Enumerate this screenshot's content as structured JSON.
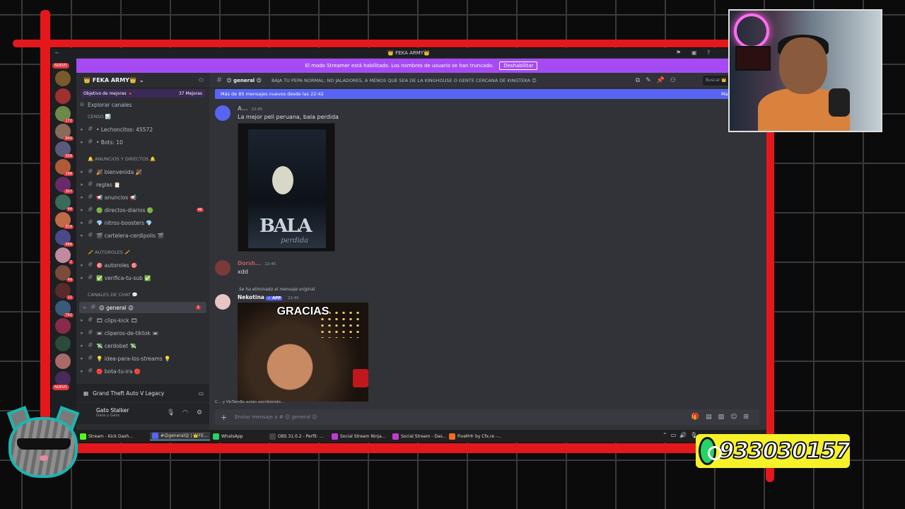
{
  "titlebar": {
    "title": "👑 FEKA ARMY👑"
  },
  "streamer_bar": {
    "message": "El modo Streamer está habilitado. Los nombres de usuario se han truncado.",
    "button": "Deshabilitar"
  },
  "servers": {
    "nuevo_top": "NUEVO",
    "nuevo_bottom": "NUEVO",
    "counts": [
      "172",
      "640",
      "508",
      "198",
      "307",
      "44",
      "819",
      "488",
      "1",
      "49",
      "11",
      "742"
    ]
  },
  "sidebar": {
    "server_name": "👑 FEKA ARMY👑",
    "boost_goal": "Objetivo de mejoras 🔺",
    "boost_count": "37 Mejoras",
    "explore": "Explorar canales",
    "items": [
      {
        "type": "cat",
        "label": "CENSO 📊"
      },
      {
        "type": "ch",
        "label": "• Lechoncitos: 45572"
      },
      {
        "type": "ch",
        "label": "• Bots: 10"
      },
      {
        "type": "cat",
        "label": "🔔 ANUNCIOS Y DIRECTOS 🔔"
      },
      {
        "type": "ch",
        "label": "🎉 bienvenida 🎉"
      },
      {
        "type": "ch",
        "label": "reglas 📋"
      },
      {
        "type": "ch",
        "label": "📢 anuncios 📢"
      },
      {
        "type": "ch",
        "label": "🟢 directos-diarios 🟢",
        "badge": "46"
      },
      {
        "type": "ch",
        "label": "💎 nitros-boosters 💎"
      },
      {
        "type": "ch",
        "label": "🎬 cartelera-cerdipolis 🎬"
      },
      {
        "type": "cat",
        "label": "🥕 AUTOROLES 🥕"
      },
      {
        "type": "ch",
        "label": "🎯 autoroles 🎯"
      },
      {
        "type": "ch",
        "label": "✅ verifica-tu-sub ✅"
      },
      {
        "type": "cat",
        "label": "CANALES DE CHAT 💬"
      },
      {
        "type": "ch",
        "label": "😉 general 😉",
        "badge": "1",
        "active": true
      },
      {
        "type": "ch",
        "label": "🎞 clips-kick 🎞"
      },
      {
        "type": "ch",
        "label": "📼 cliperos-de-tiktok 📼"
      },
      {
        "type": "ch",
        "label": "💸 cerdobet 💸"
      },
      {
        "type": "ch",
        "label": "💡 idea-para-los-streams 💡"
      },
      {
        "type": "ch",
        "label": "🔴 bota-tu-ira 🔴"
      }
    ],
    "voice_activity": "Grand Theft Auto V Legacy",
    "user_name": "Gato Stalker",
    "user_status": "Gata y Gato"
  },
  "channel": {
    "name": "😉 general 😉",
    "topic": "BAJA TU PEPA NORMAL; NO JALADORES, A MENOS QUE SEA DE LA KINGHOUSE O GENTE CERCANA DE KINGTEKA 😊",
    "search_placeholder": "Buscar 👑 FEKA ARMY👑"
  },
  "new_messages": {
    "text": "Más de 85 mensajes nuevos desde las 22:42",
    "mark": "Marcar como leído"
  },
  "messages": [
    {
      "user": "A...",
      "time": "22:45",
      "text": "La mejor peli peruana, bala perdida",
      "poster_title": "BALA",
      "poster_subtitle": "perdida"
    },
    {
      "user": "Dorsh...",
      "time": "22:45",
      "text": "xdd"
    },
    {
      "deleted": "Se ha eliminado el mensaje original",
      "user": "Nekotina",
      "tag": "✓ APP",
      "time": "22:45",
      "gif_text": "GRACIAS"
    }
  ],
  "typing": "C... y VicTamBo están escribiendo...",
  "composer": {
    "placeholder": "Enviar mensaje a # 😉 general 😉"
  },
  "taskbar": [
    {
      "label": "Stream - Kick Dash...",
      "color": "#53fc18"
    },
    {
      "label": "#😉general😉 | 👑FE...",
      "color": "#5865f2",
      "active": true
    },
    {
      "label": "WhatsApp",
      "color": "#25d366"
    },
    {
      "label": "OBS 31.0.2 - Perfil: ...",
      "color": "#444"
    },
    {
      "label": "Social Stream Ninja...",
      "color": "#c23bd6"
    },
    {
      "label": "Social Stream - Das...",
      "color": "#c23bd6"
    },
    {
      "label": "FiveM® by Cfx.re -...",
      "color": "#f26c22"
    }
  ],
  "overlay": {
    "whatsapp_number": "933030157"
  }
}
